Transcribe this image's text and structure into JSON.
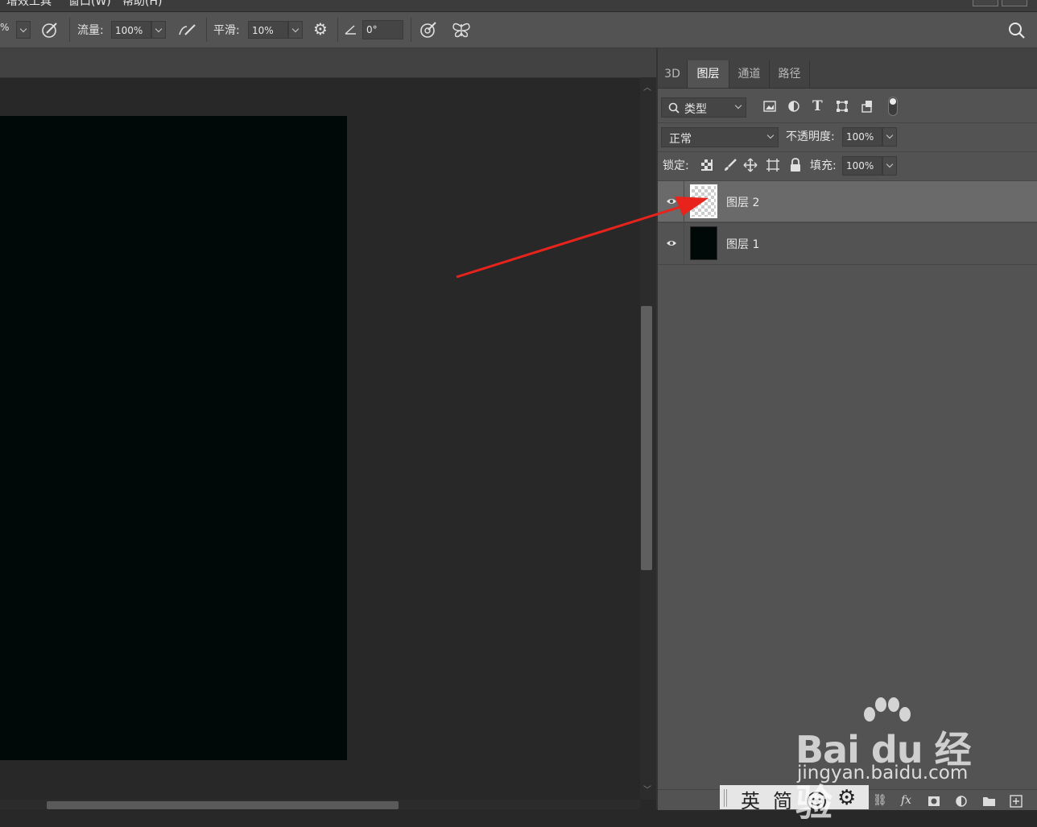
{
  "menu": {
    "items": [
      "增效工具",
      "窗口(W)",
      "帮助(H)"
    ]
  },
  "options": {
    "size_fragment": "%",
    "flow_label": "流量:",
    "flow_value": "100%",
    "smooth_label": "平滑:",
    "smooth_value": "10%",
    "angle_value": "0°"
  },
  "panel": {
    "tabs": [
      "3D",
      "图层",
      "通道",
      "路径"
    ],
    "active_tab": "图层",
    "filter_kind": "类型",
    "blend_mode": "正常",
    "opacity_label": "不透明度:",
    "opacity_value": "100%",
    "lock_label": "锁定:",
    "fill_label": "填充:",
    "fill_value": "100%",
    "layers": [
      {
        "name": "图层 2",
        "selected": true,
        "thumb": "transparent"
      },
      {
        "name": "图层 1",
        "selected": false,
        "thumb": "black"
      }
    ]
  },
  "ime": {
    "chars": [
      "英",
      "简"
    ]
  },
  "watermark": {
    "brand": "Bai du 经验",
    "url": "jingyan.baidu.com"
  },
  "colors": {
    "annotation_arrow": "#e8231c",
    "selected_layer_bg": "#6a6a6a",
    "document_fill": "#010808"
  }
}
